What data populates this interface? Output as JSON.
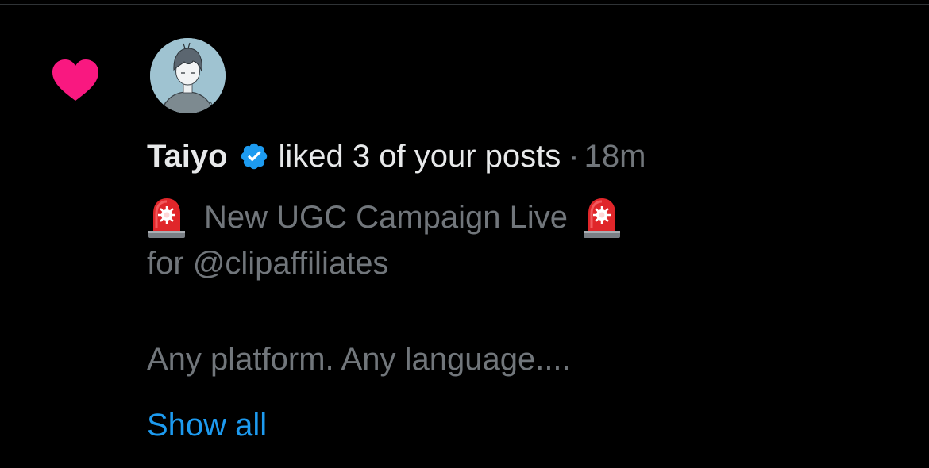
{
  "notification": {
    "type_icon": "heart-icon",
    "user": {
      "name": "Taiyo",
      "verified": true,
      "avatar": "anime-character-avatar"
    },
    "action": "liked 3 of your posts",
    "separator": "·",
    "time": "18m",
    "post": {
      "line1": "New UGC Campaign Live",
      "line2": "for @clipaffiliates",
      "line3": "Any platform. Any language....",
      "emoji": "police-car-light"
    },
    "show_all": "Show all"
  },
  "colors": {
    "background": "#000000",
    "heart": "#f91880",
    "verified": "#1d9bf0",
    "link": "#1d9bf0",
    "primary_text": "#e7e9ea",
    "secondary_text": "#71767b"
  }
}
